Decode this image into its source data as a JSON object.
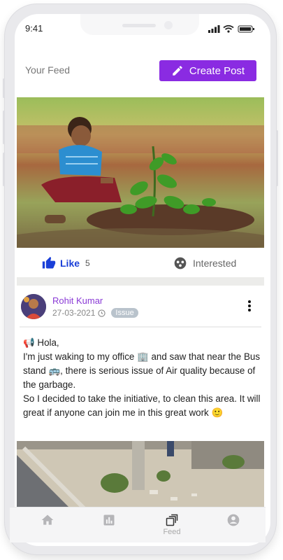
{
  "status_bar": {
    "time": "9:41"
  },
  "header": {
    "title": "Your Feed",
    "create_post_label": "Create Post"
  },
  "feed": {
    "post1": {
      "image_alt": "Boy planting a sapling",
      "like_label": "Like",
      "like_count": "5",
      "interested_label": "Interested"
    },
    "post2": {
      "author": "Rohit Kumar",
      "date": "27-03-2021",
      "tag": "Issue",
      "body_lines": [
        "📢 Hola,",
        "I'm just waking to my office 🏢 and saw that near the Bus stand 🚌, there is serious issue of Air quality because of the garbage.",
        "So I decided to take the initiative, to clean this area. It will great if anyone can join me in this great work 🙂"
      ]
    }
  },
  "bottom_nav": {
    "feed_label": "Feed"
  },
  "colors": {
    "accent": "#8a2be2",
    "like": "#1a3fd8",
    "author": "#8a3ad6"
  }
}
